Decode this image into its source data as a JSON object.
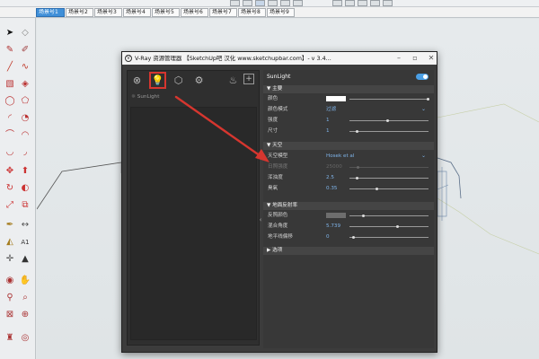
{
  "scene_tabs": [
    "场景号1",
    "场景号2",
    "场景号3",
    "场景号4",
    "场景号5",
    "场景号6",
    "场景号7",
    "场景号8",
    "场景号9"
  ],
  "vray": {
    "title": "V-Ray 资源管理器 【SketchUp吧 汉化 www.sketchupbar.com】- v 3.4...",
    "asset_item": "SunLight",
    "light_name": "SunLight",
    "sections": {
      "main": "主要",
      "sky": "天空",
      "ground": "地面反射率",
      "options": "选项"
    },
    "main_rows": [
      {
        "label": "颜色",
        "value": ""
      },
      {
        "label": "颜色模式",
        "value": "过滤"
      },
      {
        "label": "强度",
        "value": "1"
      },
      {
        "label": "尺寸",
        "value": "1"
      }
    ],
    "sky_rows": [
      {
        "label": "天空模型",
        "value": "Hosek et al"
      },
      {
        "label": "日照强度",
        "value": "25000"
      },
      {
        "label": "浑浊度",
        "value": "2.5"
      },
      {
        "label": "臭氧",
        "value": "0.35"
      }
    ],
    "ground_rows": [
      {
        "label": "反照颜色",
        "value": ""
      },
      {
        "label": "混合角度",
        "value": "5.739"
      },
      {
        "label": "地平线偏移",
        "value": "0"
      }
    ]
  },
  "colors": {
    "accent": "#4a9fe5",
    "annotation": "#d6362f",
    "panel": "#3c3c3c"
  }
}
